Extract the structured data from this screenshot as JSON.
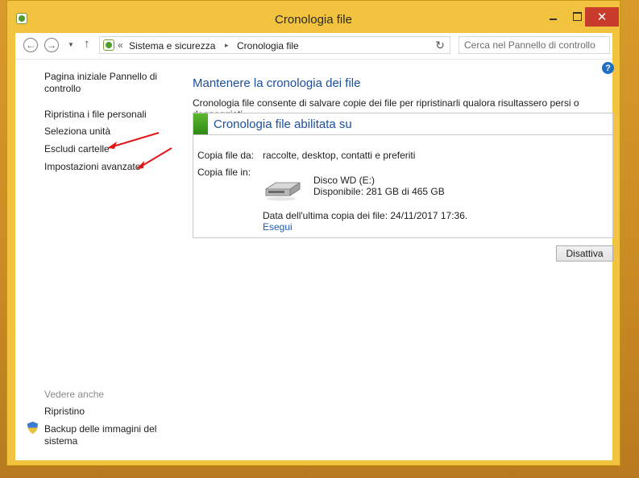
{
  "window": {
    "title": "Cronologia file",
    "accent_color": "#f2c33e",
    "close_color": "#c83a2a"
  },
  "navbar": {
    "back_label": "←",
    "forward_label": "→",
    "up_label": "↑",
    "breadcrumb": {
      "prefix": "«",
      "items": [
        "Sistema e sicurezza",
        "Cronologia file"
      ],
      "separator": "▸"
    },
    "refresh_label": "↻",
    "search_placeholder": "Cerca nel Pannello di controllo"
  },
  "sidebar": {
    "home_link_line1": "Pagina iniziale Pannello di",
    "home_link_line2": "controllo",
    "items": [
      "Ripristina i file personali",
      "Seleziona unità",
      "Escludi cartelle",
      "Impostazioni avanzate"
    ],
    "see_also_heading": "Vedere anche",
    "see_also_items": [
      "Ripristino"
    ],
    "backup_line1": "Backup delle immagini del",
    "backup_line2": "sistema"
  },
  "main": {
    "title": "Mantenere la cronologia dei file",
    "description": "Cronologia file consente di salvare copie dei file per ripristinarli qualora risultassero persi o danneggiati.",
    "panel": {
      "status_title": "Cronologia file abilitata su",
      "status_color": "#3a9a1e",
      "copy_from_label": "Copia file da:",
      "copy_from_value": "raccolte, desktop, contatti e preferiti",
      "copy_to_label": "Copia file in:",
      "drive_name": "Disco WD (E:)",
      "drive_free": "Disponibile: 281 GB di 465 GB",
      "last_copy": "Data dell'ultima copia dei file: 24/11/2017 17:36.",
      "run_link": "Esegui"
    },
    "disable_button": "Disattiva"
  },
  "annotations": {
    "arrow_color": "#e01818"
  }
}
